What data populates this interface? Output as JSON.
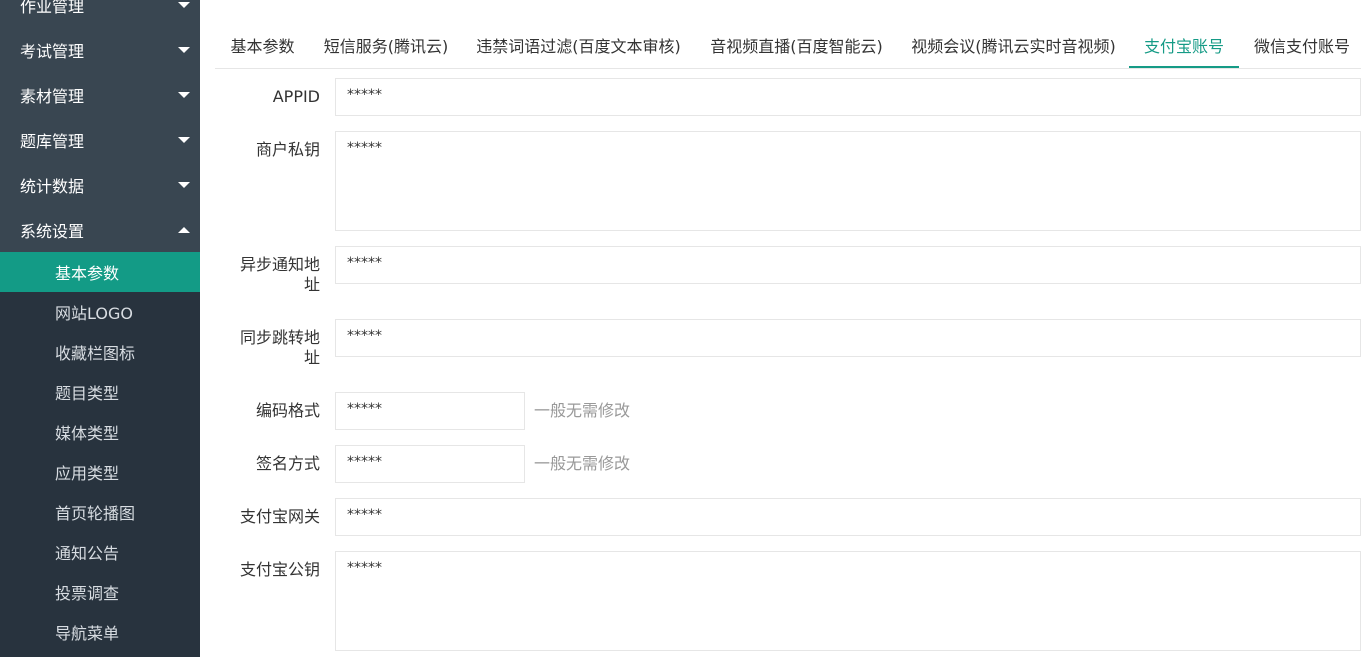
{
  "sidebar": {
    "menus": [
      {
        "label": "作业管理"
      },
      {
        "label": "考试管理"
      },
      {
        "label": "素材管理"
      },
      {
        "label": "题库管理"
      },
      {
        "label": "统计数据"
      },
      {
        "label": "系统设置"
      }
    ],
    "subitems": [
      {
        "label": "基本参数"
      },
      {
        "label": "网站LOGO"
      },
      {
        "label": "收藏栏图标"
      },
      {
        "label": "题目类型"
      },
      {
        "label": "媒体类型"
      },
      {
        "label": "应用类型"
      },
      {
        "label": "首页轮播图"
      },
      {
        "label": "通知公告"
      },
      {
        "label": "投票调查"
      },
      {
        "label": "导航菜单"
      }
    ]
  },
  "tabs": [
    {
      "label": "基本参数"
    },
    {
      "label": "短信服务(腾讯云)"
    },
    {
      "label": "违禁词语过滤(百度文本审核)"
    },
    {
      "label": "音视频直播(百度智能云)"
    },
    {
      "label": "视频会议(腾讯云实时音视频)"
    },
    {
      "label": "支付宝账号"
    },
    {
      "label": "微信支付账号"
    }
  ],
  "form": {
    "appid": {
      "label": "APPID",
      "value": "*****"
    },
    "private_key": {
      "label": "商户私钥",
      "value": "*****"
    },
    "notify_url": {
      "label": "异步通知地址",
      "value": "*****"
    },
    "return_url": {
      "label": "同步跳转地址",
      "value": "*****"
    },
    "charset": {
      "label": "编码格式",
      "value": "*****",
      "hint": "一般无需修改"
    },
    "sign_type": {
      "label": "签名方式",
      "value": "*****",
      "hint": "一般无需修改"
    },
    "gateway": {
      "label": "支付宝网关",
      "value": "*****"
    },
    "public_key": {
      "label": "支付宝公钥",
      "value": "*****"
    }
  },
  "colors": {
    "accent": "#159b86",
    "sidebar_bg": "#28333e",
    "sidebar_top_bg": "#394651"
  }
}
